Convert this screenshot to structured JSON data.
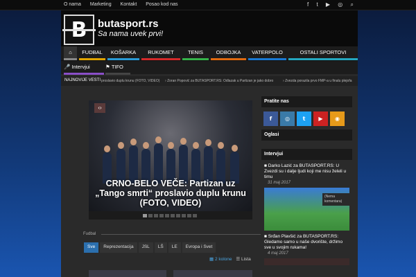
{
  "topbar": {
    "links": [
      "O nama",
      "Marketing",
      "Kontakt",
      "Posao kod nas"
    ]
  },
  "header": {
    "logo_letter": "B",
    "site_name": "butasport.rs",
    "tagline": "Sa nama uvek prvi!"
  },
  "nav": {
    "primary": [
      "FUDBAL",
      "KOŠARKA",
      "RUKOMET",
      "TENIS",
      "ODBOJKA",
      "VATERPOLO",
      "OSTALI SPORTOVI"
    ],
    "secondary": [
      "Intervjui",
      "TIFO"
    ],
    "colors": [
      "#e0a400",
      "#2a9bd6",
      "#d42a2a",
      "#35b34a",
      "#e06a10",
      "#1a7ad4",
      "#25a8c0"
    ]
  },
  "ticker": {
    "label": "NAJNOVIJE VESTI",
    "items": [
      "proslavio duplu krunu (FOTO, VIDEO)",
      "Zoran Popović za BUTASPORT.RS: Odlazak u Partizan je jako dobro",
      "Zvezda porazila prvo FMP-a u finalu plejofa"
    ]
  },
  "slider": {
    "headline": "CRNO-BELO VEČE: Partizan uz „Tango smrti“ proslavio duplu krunu (FOTO, VIDEO)"
  },
  "section": {
    "title": "Fudbal",
    "tabs": [
      "Sve",
      "Reprezentacija",
      "JSL",
      "LŠ",
      "LE",
      "Evropa i Svet"
    ],
    "view_grid": "2 kolone",
    "view_list": "Lista"
  },
  "sidebar": {
    "follow_title": "Pratite nas",
    "social": [
      "f",
      "ig",
      "t",
      "yt",
      "rss"
    ],
    "ads_title": "Oglasi",
    "interviews_title": "Intervjui",
    "interviews": [
      {
        "title": "Darko Lazić za BUTASPORT.RS: U Zvezdi su i dalje ljudi koji me nisu želeli u timu",
        "date": "31 maj 2017",
        "comments": "(Nema komentara)"
      },
      {
        "title": "Srđan Plavšić za BUTASPORT.RS: Gledamo samo u naše dvorište, držimo sve u svojim rukama!",
        "date": "4 maj 2017"
      }
    ]
  }
}
